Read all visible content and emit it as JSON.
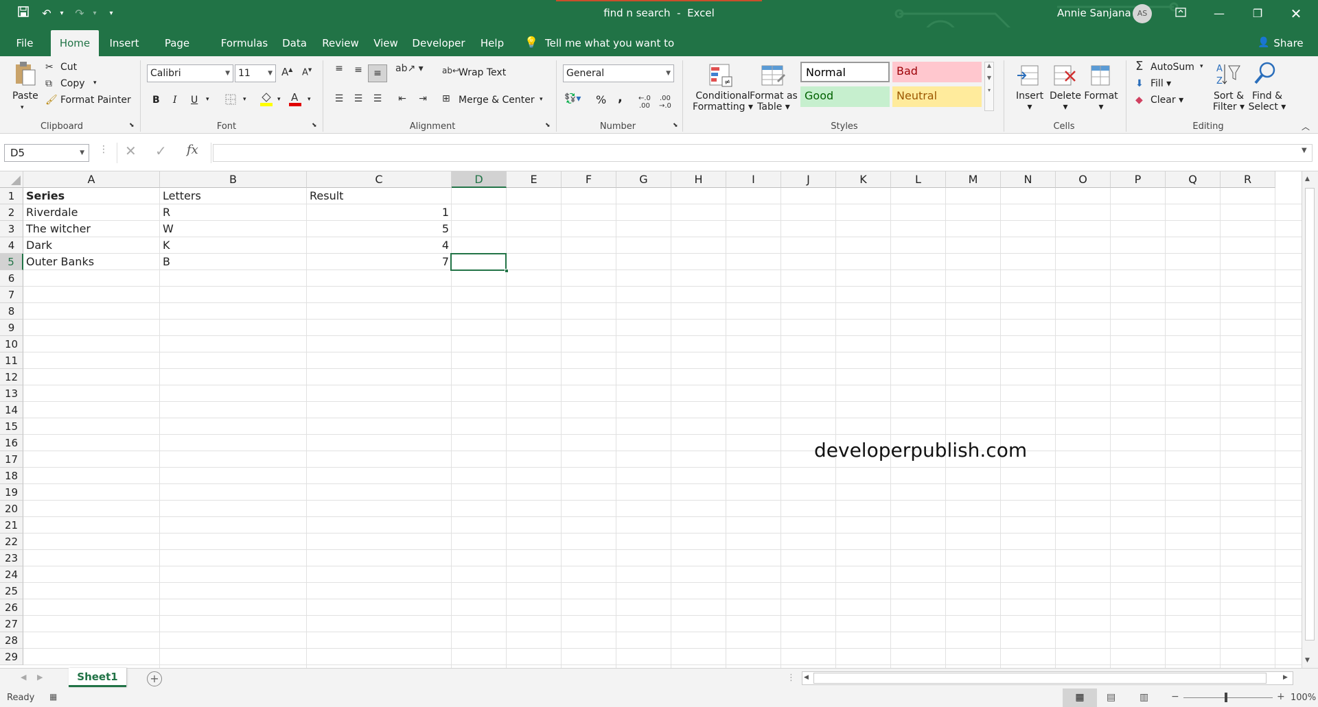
{
  "titlebar": {
    "doc_title": "find n search",
    "separator": "-",
    "app_name": "Excel",
    "user_name": "Annie Sanjana",
    "user_initials": "AS",
    "bg_color": "#217346"
  },
  "tabs": {
    "file": "File",
    "home": "Home",
    "insert": "Insert",
    "page_layout": "Page Layout",
    "formulas": "Formulas",
    "data": "Data",
    "review": "Review",
    "view": "View",
    "developer": "Developer",
    "help": "Help",
    "tell_me": "Tell me what you want to do",
    "share": "Share"
  },
  "ribbon": {
    "clipboard": {
      "paste": "Paste",
      "cut": "Cut",
      "copy": "Copy",
      "format_painter": "Format Painter",
      "label": "Clipboard"
    },
    "font": {
      "name": "Calibri",
      "size": "11",
      "bold": "B",
      "italic": "I",
      "underline": "U",
      "label": "Font"
    },
    "alignment": {
      "wrap_text": "Wrap Text",
      "merge_center": "Merge & Center",
      "label": "Alignment"
    },
    "number": {
      "format": "General",
      "percent": "%",
      "comma": ",",
      "label": "Number"
    },
    "styles": {
      "conditional_1": "Conditional",
      "conditional_2": "Formatting",
      "format_table_1": "Format as",
      "format_table_2": "Table",
      "normal": "Normal",
      "bad": "Bad",
      "good": "Good",
      "neutral": "Neutral",
      "label": "Styles"
    },
    "cells": {
      "insert": "Insert",
      "delete": "Delete",
      "format": "Format",
      "label": "Cells"
    },
    "editing": {
      "autosum": "AutoSum",
      "fill": "Fill",
      "clear": "Clear",
      "sort_1": "Sort &",
      "sort_2": "Filter",
      "find_1": "Find &",
      "find_2": "Select",
      "label": "Editing"
    }
  },
  "formula_bar": {
    "name_box": "D5",
    "fx": "fx",
    "value": ""
  },
  "sheet": {
    "columns": [
      "A",
      "B",
      "C",
      "D",
      "E",
      "F",
      "G",
      "H",
      "I",
      "J",
      "K",
      "L",
      "M",
      "N",
      "O",
      "P",
      "Q",
      "R"
    ],
    "rows": [
      "1",
      "2",
      "3",
      "4",
      "5",
      "6",
      "7",
      "8",
      "9",
      "10",
      "11",
      "12",
      "13",
      "14",
      "15",
      "16",
      "17",
      "18",
      "19",
      "20",
      "21",
      "22",
      "23",
      "24",
      "25",
      "26",
      "27",
      "28",
      "29"
    ],
    "header": {
      "a": "Series",
      "b": "Letters",
      "c": "Result"
    },
    "data": [
      {
        "a": "Riverdale",
        "b": "R",
        "c": "1"
      },
      {
        "a": "The witcher",
        "b": "W",
        "c": "5"
      },
      {
        "a": "Dark",
        "b": "K",
        "c": "4"
      },
      {
        "a": "Outer Banks",
        "b": "B",
        "c": "7"
      }
    ],
    "watermark": "developerpublish.com",
    "selected_cell": "D5"
  },
  "sheet_tabs": {
    "active": "Sheet1"
  },
  "status": {
    "ready": "Ready",
    "zoom": "100%"
  }
}
